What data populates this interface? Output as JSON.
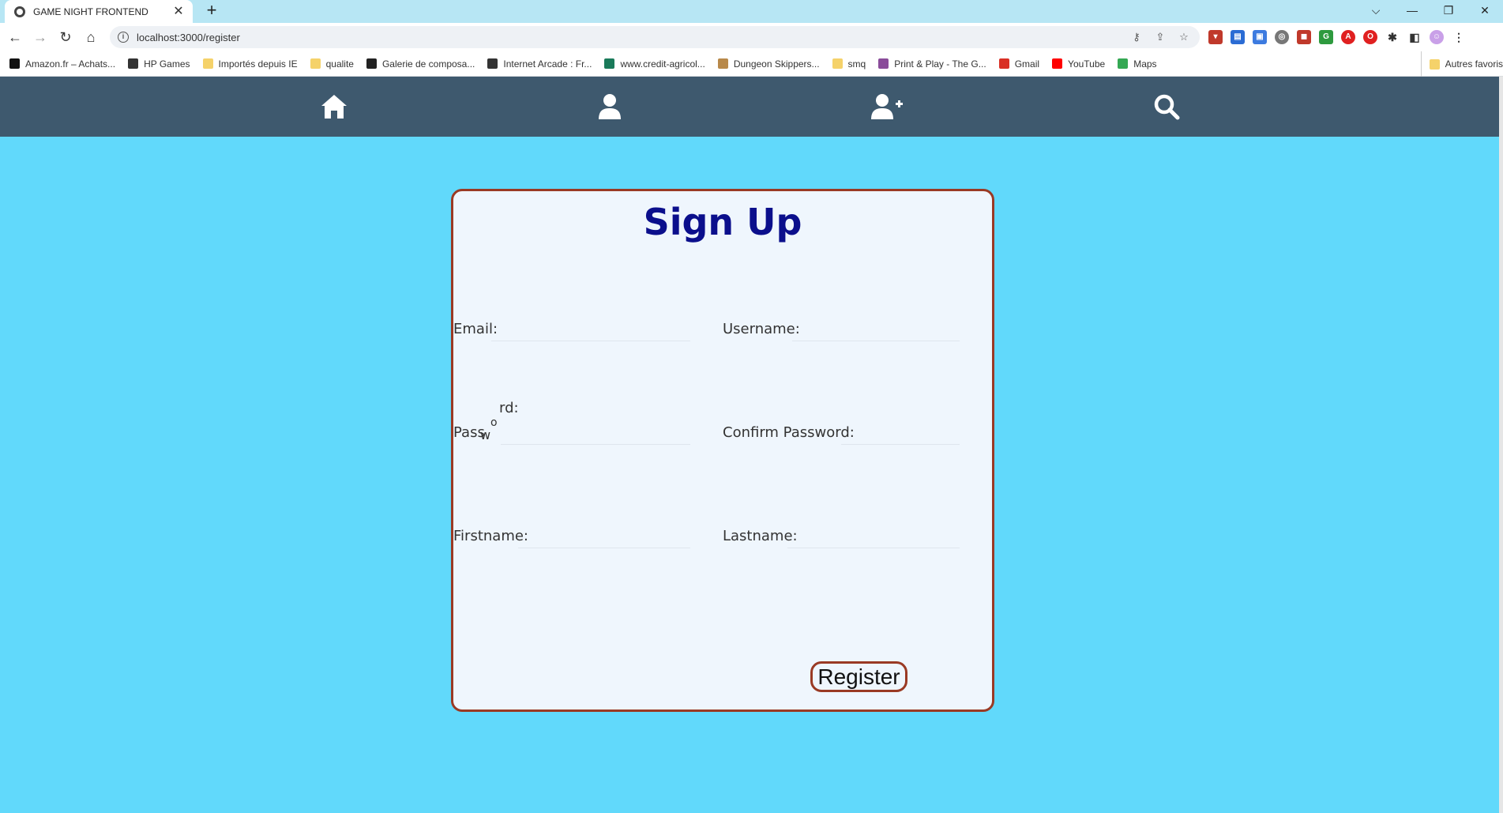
{
  "browser": {
    "tab": {
      "title": "GAME NIGHT FRONTEND",
      "close": "✕"
    },
    "new_tab": "+",
    "window_controls": {
      "dropdown": "⌵",
      "minimize": "—",
      "restore": "❐",
      "close": "✕"
    },
    "url": "localhost:3000/register",
    "bookmarks": [
      {
        "label": "Amazon.fr – Achats...",
        "color": "#111111"
      },
      {
        "label": "HP Games",
        "color": "#333333"
      },
      {
        "label": "Importés depuis IE",
        "color": "#f5d26a"
      },
      {
        "label": "qualite",
        "color": "#f5d26a"
      },
      {
        "label": "Galerie de composa...",
        "color": "#222222"
      },
      {
        "label": "Internet Arcade : Fr...",
        "color": "#333333"
      },
      {
        "label": "www.credit-agricol...",
        "color": "#1a7a5a"
      },
      {
        "label": "Dungeon Skippers...",
        "color": "#b8894a"
      },
      {
        "label": "smq",
        "color": "#f5d26a"
      },
      {
        "label": "Print & Play - The G...",
        "color": "#8a4c9a"
      },
      {
        "label": "Gmail",
        "color": "#d93025"
      },
      {
        "label": "YouTube",
        "color": "#ff0000"
      },
      {
        "label": "Maps",
        "color": "#34a853"
      }
    ],
    "other_bookmarks": "Autres favoris"
  },
  "nav": {
    "icons": [
      "home-icon",
      "user-icon",
      "user-plus-icon",
      "search-icon"
    ]
  },
  "form": {
    "title": "Sign Up",
    "email_label": "Email:",
    "username_label": "Username:",
    "password_label_start": "Pass",
    "password_label_w": "w",
    "password_label_o": "o",
    "password_label_end": "rd:",
    "confirm_password_label": "Confirm Password:",
    "firstname_label": "Firstname:",
    "lastname_label": "Lastname:",
    "register_button": "Register"
  },
  "colors": {
    "page_bg": "#61d9fb",
    "nav_bg": "#3e596e",
    "card_bg": "#eff6fd",
    "card_border": "#9a3a24",
    "title": "#0b0f8c"
  }
}
